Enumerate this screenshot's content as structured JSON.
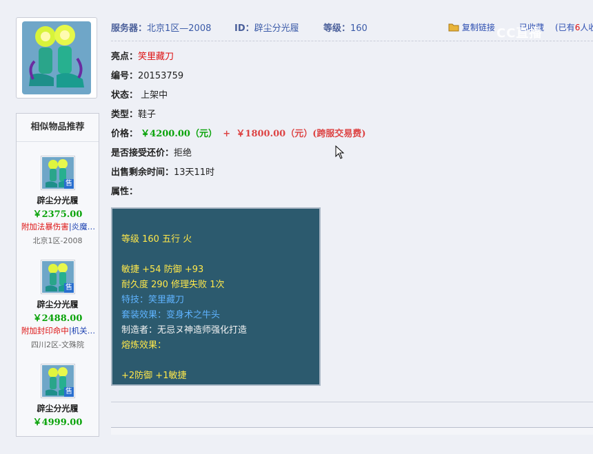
{
  "header": {
    "server_label": "服务器：",
    "server_value": "北京1区—2008",
    "id_label": "ID：",
    "id_value": "辟尘分光履",
    "level_label": "等级：",
    "level_value": "160",
    "copy_link": "复制链接",
    "fav_label": "已收藏",
    "fav_prefix": "(已有",
    "fav_count": "6",
    "fav_suffix": "人收"
  },
  "details": {
    "highlight_label": "亮点：",
    "highlight_value": "笑里藏刀",
    "serial_label": "编号：",
    "serial_value": "20153759",
    "status_label": "状态：",
    "status_value": "上架中",
    "type_label": "类型：",
    "type_value": "鞋子",
    "price_label": "价格：",
    "price_main": "￥4200.00（元）",
    "price_plus": "+",
    "price_fee": "￥1800.00（元）(跨服交易费)",
    "counter_label": "是否接受还价：",
    "counter_value": "拒绝",
    "remaining_label": "出售剩余时间：",
    "remaining_value": "13天11时",
    "attr_label": "属性："
  },
  "attributes": {
    "level_line": "等级 160 五行 火",
    "stats_line": "敏捷 +54 防御 +93",
    "durability_line": "耐久度 290 修理失败 1次",
    "skill_line": "特技：笑里藏刀",
    "set_line": "套装效果：变身术之牛头",
    "maker_line": "制造者：无忌ヌ神造师强化打造",
    "smelt_line": "熔炼效果：",
    "smelt_bonus": "+2防御 +1敏捷"
  },
  "sidebar": {
    "title": "相似物品推荐",
    "badge": "售",
    "items": [
      {
        "name": "辟尘分光履",
        "price": "￥2375.00",
        "attr_red": "附加法暴伤害",
        "attr_blue": "|炎魔…",
        "server": "北京1区-2008"
      },
      {
        "name": "辟尘分光履",
        "price": "￥2488.00",
        "attr_red": "附加封印命中",
        "attr_blue": "|机关…",
        "server": "四川2区-文殊院"
      },
      {
        "name": "辟尘分光履",
        "price": "￥4999.00"
      }
    ]
  },
  "watermark": "CC直播",
  "colors": {
    "accent_blue": "#3a5aa8",
    "price_green": "#0aa30a",
    "price_red": "#d44444",
    "attr_box_bg": "#2c5a6e",
    "attr_yellow": "#ffe84a",
    "attr_blue": "#5fb3ff"
  }
}
